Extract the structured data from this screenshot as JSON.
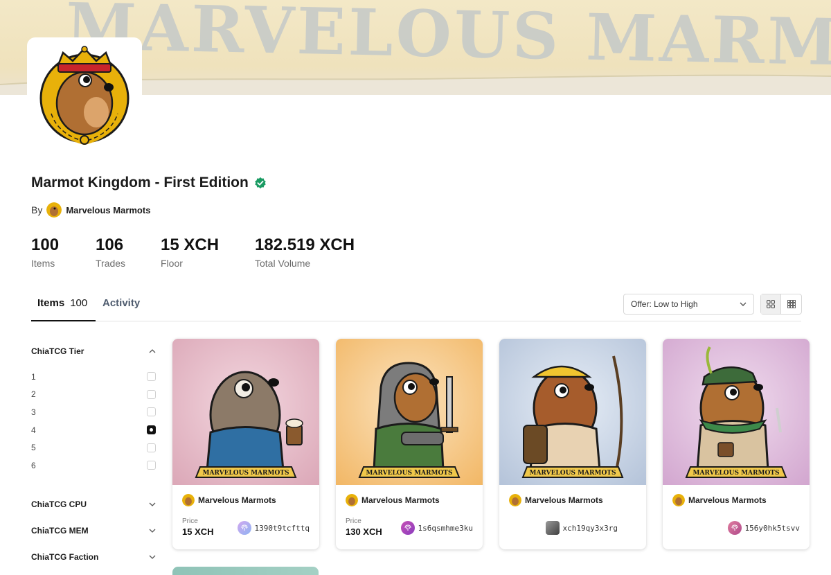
{
  "banner": {
    "text": "MARVELOUS MARMOTS"
  },
  "collection": {
    "title": "Marmot Kingdom - First Edition",
    "verified": true,
    "by_label": "By",
    "creator": "Marvelous Marmots"
  },
  "stats": [
    {
      "value": "100",
      "label": "Items"
    },
    {
      "value": "106",
      "label": "Trades"
    },
    {
      "value": "15 XCH",
      "label": "Floor"
    },
    {
      "value": "182.519 XCH",
      "label": "Total Volume"
    }
  ],
  "tabs": [
    {
      "label": "Items",
      "count": "100",
      "active": true
    },
    {
      "label": "Activity",
      "active": false
    }
  ],
  "sort": {
    "selected": "Offer: Low to High"
  },
  "filters": {
    "tier": {
      "label": "ChiaTCG Tier",
      "options": [
        "1",
        "2",
        "3",
        "4",
        "5",
        "6"
      ],
      "checked": "4"
    },
    "collapsed": [
      "ChiaTCG CPU",
      "ChiaTCG MEM",
      "ChiaTCG Faction"
    ]
  },
  "cards": [
    {
      "collection": "Marvelous Marmots",
      "price_label": "Price",
      "price": "15 XCH",
      "owner": "1390t9tcfttq",
      "bg": "pink",
      "scroll_text": "MARVELOUS MARMOTS"
    },
    {
      "collection": "Marvelous Marmots",
      "price_label": "Price",
      "price": "130 XCH",
      "owner": "1s6qsmhme3ku",
      "bg": "orange",
      "scroll_text": "MARVELOUS MARMOTS"
    },
    {
      "collection": "Marvelous Marmots",
      "owner": "xch19qy3x3rg",
      "bg": "blue",
      "scroll_text": "MARVELOUS MARMOTS"
    },
    {
      "collection": "Marvelous Marmots",
      "owner": "156y0hk5tsvv",
      "bg": "purple",
      "scroll_text": "MARVELOUS MARMOTS"
    }
  ],
  "colors": {
    "verified": "#1a9b63",
    "banner_bg": "#f1e5c2",
    "crown_gold": "#e8b10a",
    "marmot_brown": "#b06f33"
  },
  "icons": [
    "check-verified-icon",
    "chevron-down-icon",
    "chevron-up-icon",
    "grid-large-icon",
    "grid-small-icon",
    "fingerprint-icon"
  ]
}
